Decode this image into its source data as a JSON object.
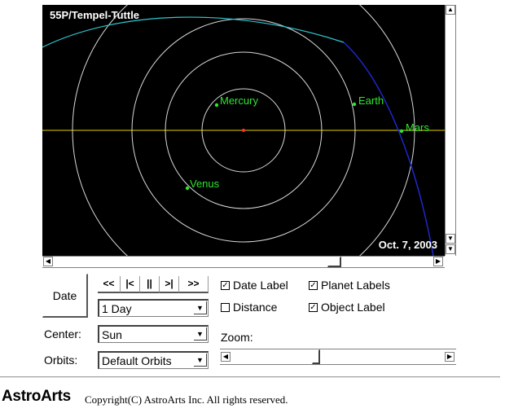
{
  "view": {
    "title": "55P/Tempel-Tuttle",
    "date": "Oct. 7, 2003",
    "planets": [
      {
        "name": "Mercury",
        "color": "#2ee62e"
      },
      {
        "name": "Earth",
        "color": "#2ee62e"
      },
      {
        "name": "Mars",
        "color": "#2ee62e"
      },
      {
        "name": "Venus",
        "color": "#2ee62e"
      }
    ],
    "colors": {
      "background": "#000000",
      "orbit": "#d8d8d8",
      "ecliptic_line": "#e8d000",
      "comet_orbit_near": "#1f2ad8",
      "comet_orbit_far": "#2ec8d0",
      "sun": "#ff3030"
    }
  },
  "controls": {
    "date_button": "Date",
    "nav": [
      "<<",
      "|<",
      "||",
      ">|",
      ">>"
    ],
    "step": {
      "value": "1 Day"
    },
    "center": {
      "label": "Center:",
      "value": "Sun"
    },
    "orbits": {
      "label": "Orbits:",
      "value": "Default Orbits"
    },
    "checkboxes": [
      {
        "label": "Date Label",
        "checked": true
      },
      {
        "label": "Planet Labels",
        "checked": true
      },
      {
        "label": "Distance",
        "checked": false
      },
      {
        "label": "Object Label",
        "checked": true
      }
    ],
    "zoom": {
      "label": "Zoom:"
    }
  },
  "footer": {
    "logo": "AstroArts",
    "copyright": "Copyright(C) AstroArts Inc. All rights reserved."
  }
}
